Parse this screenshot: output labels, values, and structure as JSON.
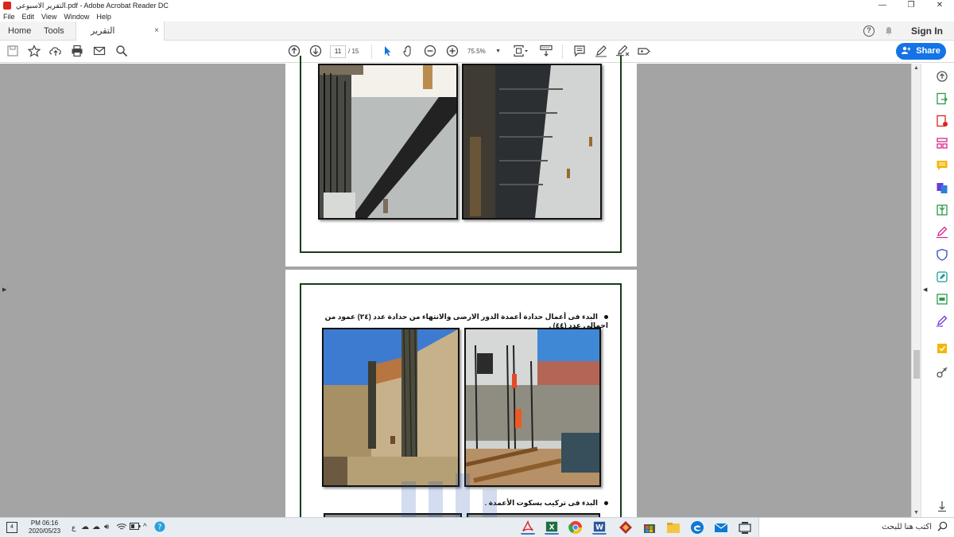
{
  "window": {
    "title": "التقرير الاسبوعي.pdf - Adobe Acrobat Reader DC",
    "controls": [
      "—",
      "❐",
      "✕"
    ]
  },
  "menu": [
    "File",
    "Edit",
    "View",
    "Window",
    "Help"
  ],
  "tabs": {
    "home": "Home",
    "tools": "Tools",
    "document": "التقرير الاسبوعي.pdf",
    "close": "×"
  },
  "header_right": {
    "help_glyph": "?",
    "sign_in": "Sign In"
  },
  "toolbar": {
    "current_page": "11",
    "total_pages": "/ 15",
    "zoom": "75.5%",
    "share_label": "Share"
  },
  "document": {
    "page2_bullet1": "البدء فى أعمال حدادة أعمدة الدور الارضى والانتهاء من حدادة عدد (٢٤) عمود من اجمالى عدد (٤٤) .",
    "page2_bullet2": "البدء فى تركيب بسكوت الأعمدة ."
  },
  "taskbar": {
    "time": "PM 06:16",
    "date": "2020/05/23",
    "lang": "ع",
    "notif": "4",
    "search_placeholder": "اكتب هنا للبحث"
  },
  "colors": {
    "accent": "#1473e6",
    "doc_bg": "#a4a4a4",
    "frame_green": "#173d17",
    "acrobat_red": "#d9261c"
  },
  "icons": {
    "toolbar": [
      "save-icon",
      "star-icon",
      "upload-icon",
      "print-icon",
      "email-icon",
      "search-icon",
      "page-up-icon",
      "page-down-icon",
      "select-arrow-icon",
      "hand-icon",
      "zoom-out-icon",
      "zoom-in-icon",
      "fit-page-icon",
      "scroll-mode-icon",
      "comment-icon",
      "pen-icon",
      "sign-icon",
      "fill-sign-icon"
    ],
    "tools_pane": [
      "zoom-in-tool-icon",
      "export-pdf-icon",
      "create-pdf-icon",
      "organize-pages-icon",
      "comment-tool-icon",
      "combine-files-icon",
      "compress-icon",
      "fill-sign-tool-icon",
      "protect-icon",
      "edit-pdf-icon",
      "print-production-icon",
      "sign-tool-icon",
      "send-review-icon",
      "more-tools-icon"
    ]
  }
}
